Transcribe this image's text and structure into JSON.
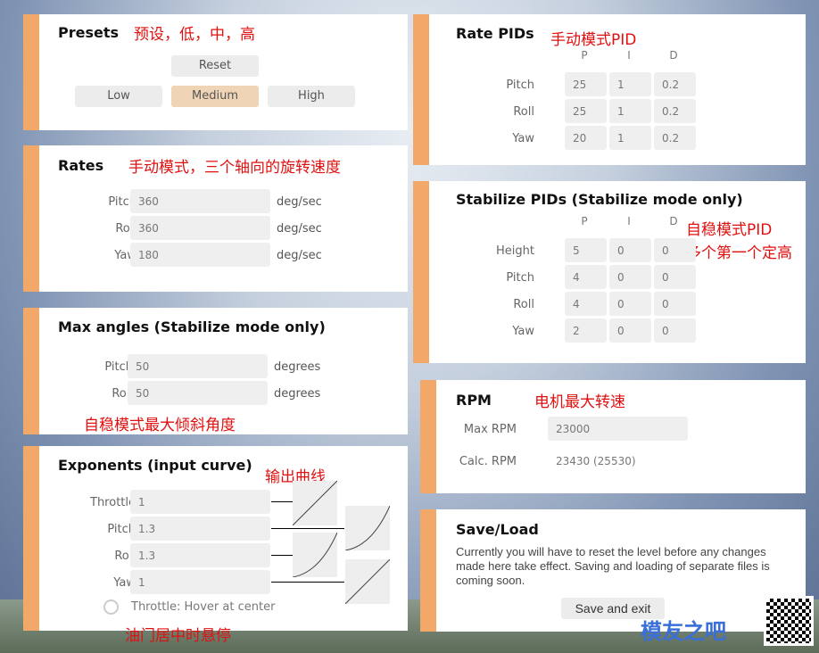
{
  "presets": {
    "title": "Presets",
    "annotation": "预设，低，中，高",
    "reset": "Reset",
    "low": "Low",
    "medium": "Medium",
    "high": "High",
    "selected": "Medium"
  },
  "rates": {
    "title": "Rates",
    "annotation": "手动模式，三个轴向的旋转速度",
    "rows": [
      {
        "label": "Pitch",
        "value": "360",
        "unit": "deg/sec"
      },
      {
        "label": "Roll",
        "value": "360",
        "unit": "deg/sec"
      },
      {
        "label": "Yaw",
        "value": "180",
        "unit": "deg/sec"
      }
    ]
  },
  "max_angles": {
    "title": "Max angles (Stabilize mode only)",
    "annotation": "自稳模式最大倾斜角度",
    "rows": [
      {
        "label": "Pitch",
        "value": "50",
        "unit": "degrees"
      },
      {
        "label": "Roll",
        "value": "50",
        "unit": "degrees"
      }
    ]
  },
  "exponents": {
    "title": "Exponents (input curve)",
    "annotation": "输出曲线",
    "rows": [
      {
        "label": "Throttle",
        "value": "1"
      },
      {
        "label": "Pitch",
        "value": "1.3"
      },
      {
        "label": "Roll",
        "value": "1.3"
      },
      {
        "label": "Yaw",
        "value": "1"
      }
    ],
    "hover_label": "Throttle: Hover at center",
    "hover_checked": false,
    "hover_annotation": "油门居中时悬停"
  },
  "rate_pids": {
    "title": "Rate PIDs",
    "annotation": "手动模式PID",
    "headers": [
      "P",
      "I",
      "D"
    ],
    "rows": [
      {
        "label": "Pitch",
        "values": [
          "25",
          "1",
          "0.2"
        ]
      },
      {
        "label": "Roll",
        "values": [
          "25",
          "1",
          "0.2"
        ]
      },
      {
        "label": "Yaw",
        "values": [
          "20",
          "1",
          "0.2"
        ]
      }
    ]
  },
  "stabilize_pids": {
    "title": "Stabilize PIDs (Stabilize mode only)",
    "annotation1": "自稳模式PID",
    "annotation2": "多个第一个定高",
    "headers": [
      "P",
      "I",
      "D"
    ],
    "rows": [
      {
        "label": "Height",
        "values": [
          "5",
          "0",
          "0"
        ]
      },
      {
        "label": "Pitch",
        "values": [
          "4",
          "0",
          "0"
        ]
      },
      {
        "label": "Roll",
        "values": [
          "4",
          "0",
          "0"
        ]
      },
      {
        "label": "Yaw",
        "values": [
          "2",
          "0",
          "0"
        ]
      }
    ]
  },
  "rpm": {
    "title": "RPM",
    "annotation": "电机最大转速",
    "max_label": "Max RPM",
    "max_value": "23000",
    "calc_label": "Calc. RPM",
    "calc_value": "23430 (25530)"
  },
  "save_load": {
    "title": "Save/Load",
    "text": "Currently you will have to reset the level before any changes made here take effect. Saving and loading of separate files is coming soon.",
    "button": "Save and exit"
  },
  "watermark": {
    "text": "模友之吧",
    "url": "http://www.moz8.com"
  },
  "colors": {
    "accent": "#f2a868",
    "annotation": "#e01010",
    "selected": "#f0d4b6"
  }
}
